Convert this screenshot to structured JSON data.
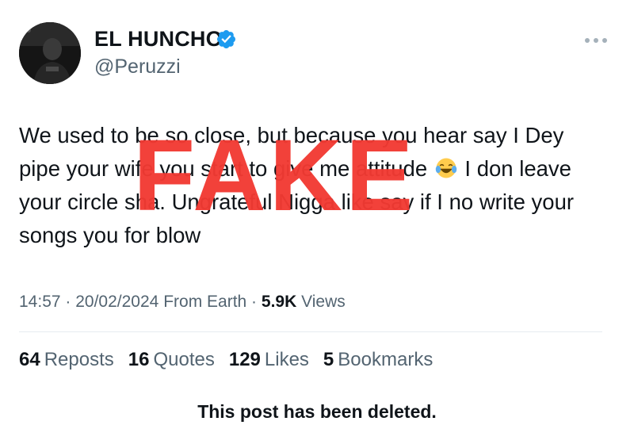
{
  "author": {
    "display_name": "EL HUNCHO",
    "handle": "@Peruzzi",
    "verified": true,
    "avatar_icon": "profile-photo"
  },
  "tweet": {
    "text_part1": "We used to be so close, but because you hear say I Dey pipe your wife you start to give me attitude",
    "emoji": "face-with-tears-of-joy",
    "text_part2": "I don leave your circle sha. Ungrateful Nigga like say if I no write your songs you for blow"
  },
  "overlay": {
    "stamp_text": "FAKE",
    "stamp_color": "#f23a33"
  },
  "meta": {
    "time": "14:57",
    "date": "20/02/2024",
    "source": "From Earth",
    "views_count": "5.9K",
    "views_label": "Views"
  },
  "stats": {
    "reposts_count": "64",
    "reposts_label": "Reposts",
    "quotes_count": "16",
    "quotes_label": "Quotes",
    "likes_count": "129",
    "likes_label": "Likes",
    "bookmarks_count": "5",
    "bookmarks_label": "Bookmarks"
  },
  "notice": "This post has been deleted.",
  "colors": {
    "text": "#0f1419",
    "secondary": "#536471",
    "verified_blue": "#1d9bf0"
  }
}
